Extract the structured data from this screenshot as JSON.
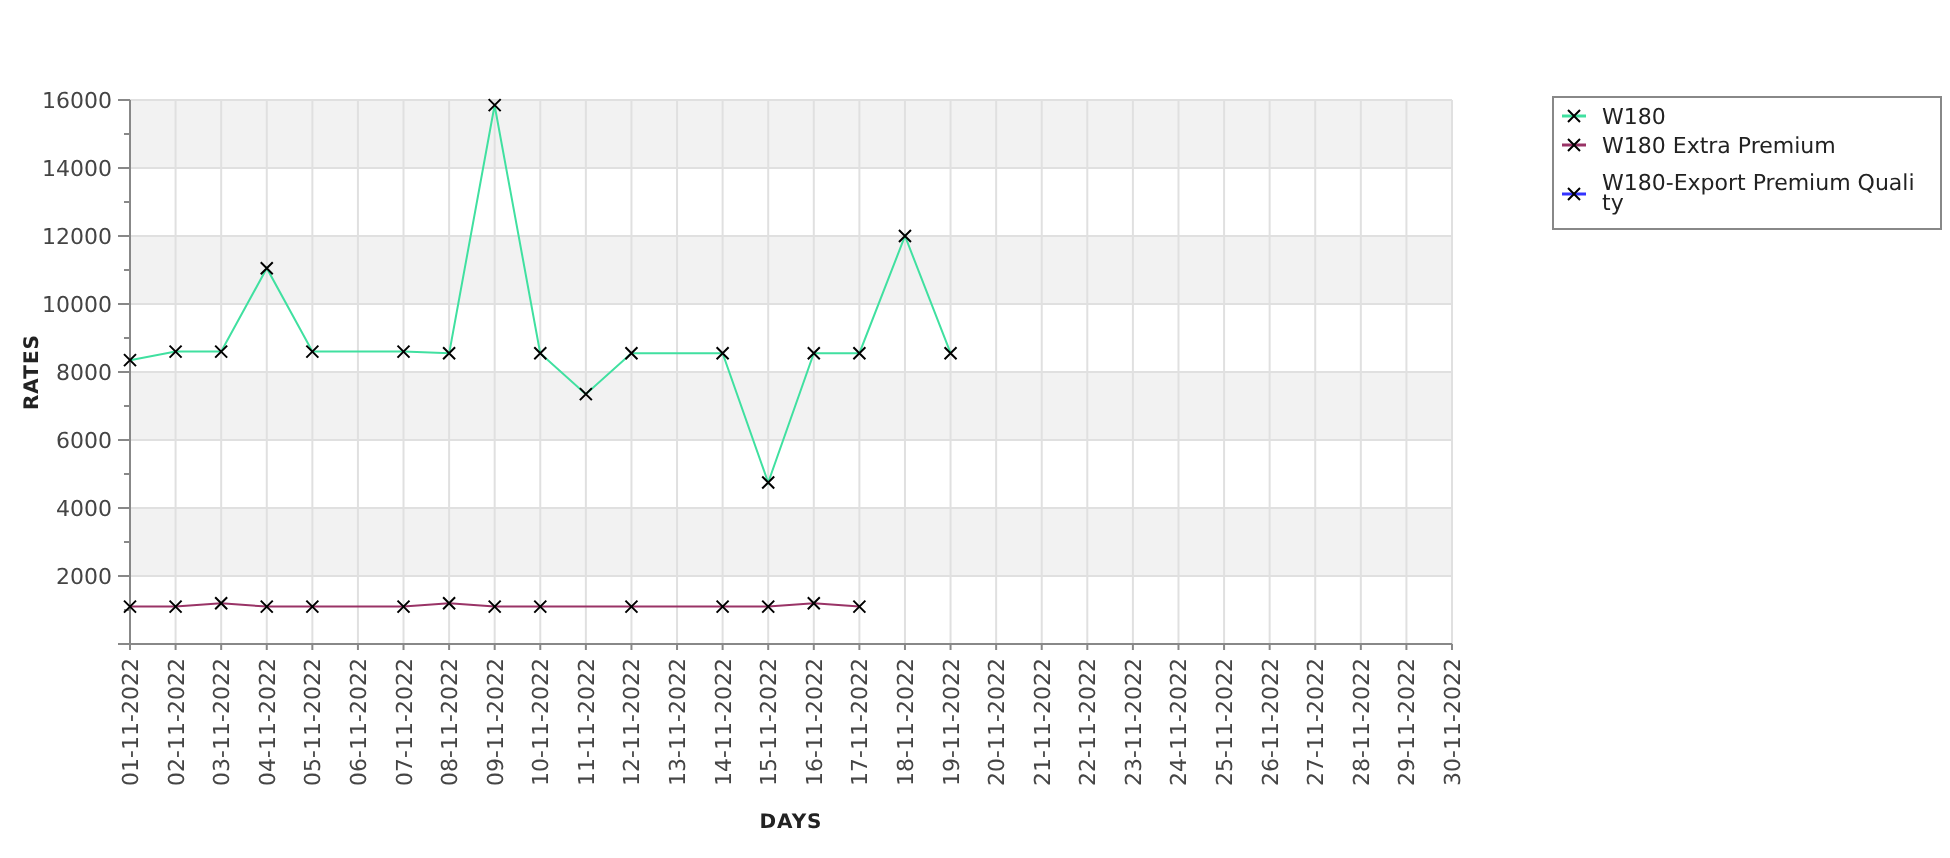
{
  "chart_data": {
    "type": "line",
    "grid": true,
    "legend": "right",
    "xlabel": "DAYS",
    "ylabel": "RATES",
    "ylim": [
      0,
      16000
    ],
    "yticks": [
      2000,
      4000,
      6000,
      8000,
      10000,
      12000,
      14000,
      16000
    ],
    "categories": [
      "01-11-2022",
      "02-11-2022",
      "03-11-2022",
      "04-11-2022",
      "05-11-2022",
      "06-11-2022",
      "07-11-2022",
      "08-11-2022",
      "09-11-2022",
      "10-11-2022",
      "11-11-2022",
      "12-11-2022",
      "13-11-2022",
      "14-11-2022",
      "15-11-2022",
      "16-11-2022",
      "17-11-2022",
      "18-11-2022",
      "19-11-2022",
      "20-11-2022",
      "21-11-2022",
      "22-11-2022",
      "23-11-2022",
      "24-11-2022",
      "25-11-2022",
      "26-11-2022",
      "27-11-2022",
      "28-11-2022",
      "29-11-2022",
      "30-11-2022"
    ],
    "series": [
      {
        "name": "W180",
        "color": "#40e0a0",
        "marker": "x",
        "values": [
          8350,
          8600,
          8600,
          11050,
          8600,
          null,
          8600,
          8550,
          15850,
          8550,
          7350,
          8550,
          null,
          8550,
          4750,
          8550,
          8550,
          12000,
          8550,
          null,
          null,
          null,
          null,
          null,
          null,
          null,
          null,
          null,
          null,
          null
        ]
      },
      {
        "name": "W180 Extra Premium",
        "color": "#993366",
        "marker": "x",
        "values": [
          1100,
          1100,
          1200,
          1100,
          1100,
          null,
          1100,
          1200,
          1100,
          1100,
          null,
          1100,
          null,
          1100,
          1100,
          1200,
          1100,
          null,
          null,
          null,
          null,
          null,
          null,
          null,
          null,
          null,
          null,
          null,
          null,
          null
        ]
      },
      {
        "name": "W180-Export Premium Quality",
        "color": "#3333ff",
        "marker": "x",
        "values": [
          null,
          null,
          null,
          null,
          null,
          null,
          null,
          null,
          null,
          null,
          null,
          null,
          null,
          null,
          null,
          null,
          null,
          null,
          null,
          null,
          null,
          null,
          null,
          null,
          null,
          null,
          null,
          null,
          null,
          null
        ]
      }
    ]
  }
}
